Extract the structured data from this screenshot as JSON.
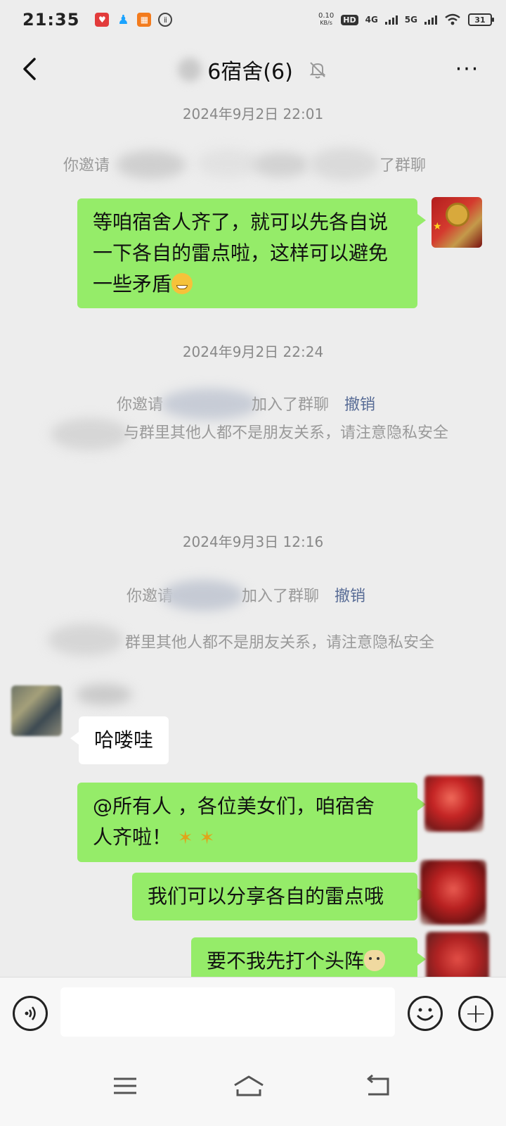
{
  "status_bar": {
    "time": "21:35",
    "net_speed_value": "0.10",
    "net_speed_unit": "KB/s",
    "hd_label": "HD",
    "sim1_label": "4G",
    "sim2_label": "5G",
    "battery": "31",
    "app_icons": [
      "heart-app-icon",
      "qq-penguin-icon",
      "app-grid-icon",
      "speed-app-icon"
    ]
  },
  "header": {
    "title": "6宿舍(6)",
    "mute_icon": "bell-muted-icon",
    "more_label": "···"
  },
  "messages": {
    "ts1": "2024年9月2日 22:01",
    "sys1_prefix": "你邀请",
    "sys1_suffix": "了群聊",
    "msg1": "等咱宿舍人齐了，就可以先各自说一下各自的雷点啦，这样可以避免一些矛盾",
    "ts2": "2024年9月2日 22:24",
    "sys2_prefix": "你邀请",
    "sys2_suffix": "加入了群聊",
    "sys2_link": "撤销",
    "sys3_text": "与群里其他人都不是朋友关系，请注意隐私安全",
    "ts3": "2024年9月3日 12:16",
    "sys4_prefix": "你邀请",
    "sys4_suffix": "加入了群聊",
    "sys4_link": "撤销",
    "sys5_text": "群里其他人都不是朋友关系，请注意隐私安全",
    "msg2": "哈喽哇",
    "msg3_line1": "@所有人  ，各位美女们，咱宿舍",
    "msg3_line2": "人齐啦！",
    "msg4": "我们可以分享各自的雷点哦",
    "msg5": "要不我先打个头阵"
  },
  "input": {
    "value": "",
    "placeholder": ""
  },
  "colors": {
    "my_bubble": "#95ec69",
    "other_bubble": "#ffffff",
    "link": "#576b95",
    "background": "#ededed"
  }
}
